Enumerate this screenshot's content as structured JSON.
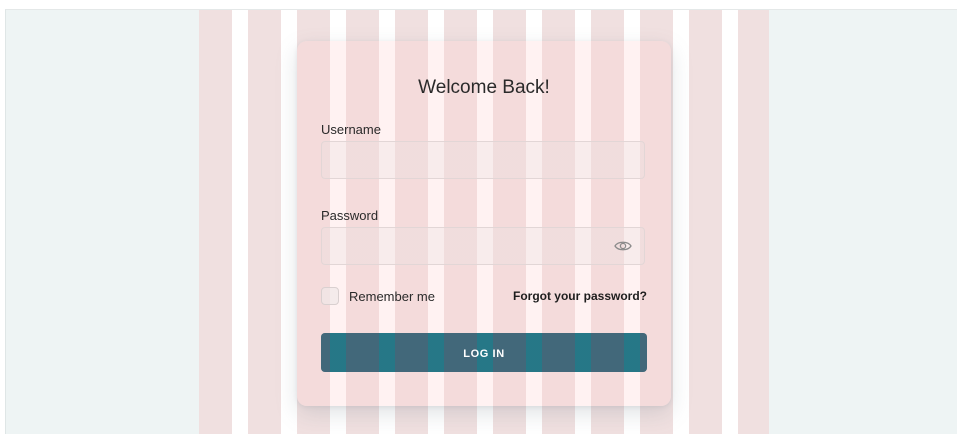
{
  "login": {
    "title": "Welcome Back!",
    "username_label": "Username",
    "username_value": "",
    "password_label": "Password",
    "password_value": "",
    "remember_label": "Remember me",
    "remember_checked": false,
    "forgot_label": "Forgot your password?",
    "submit_label": "LOG IN",
    "show_password_icon": "eye-icon"
  },
  "colors": {
    "page_background": "#eef4f4",
    "stripe": "#f0e0e0",
    "button": "#2f6f7f",
    "text": "#2a2a2a"
  }
}
